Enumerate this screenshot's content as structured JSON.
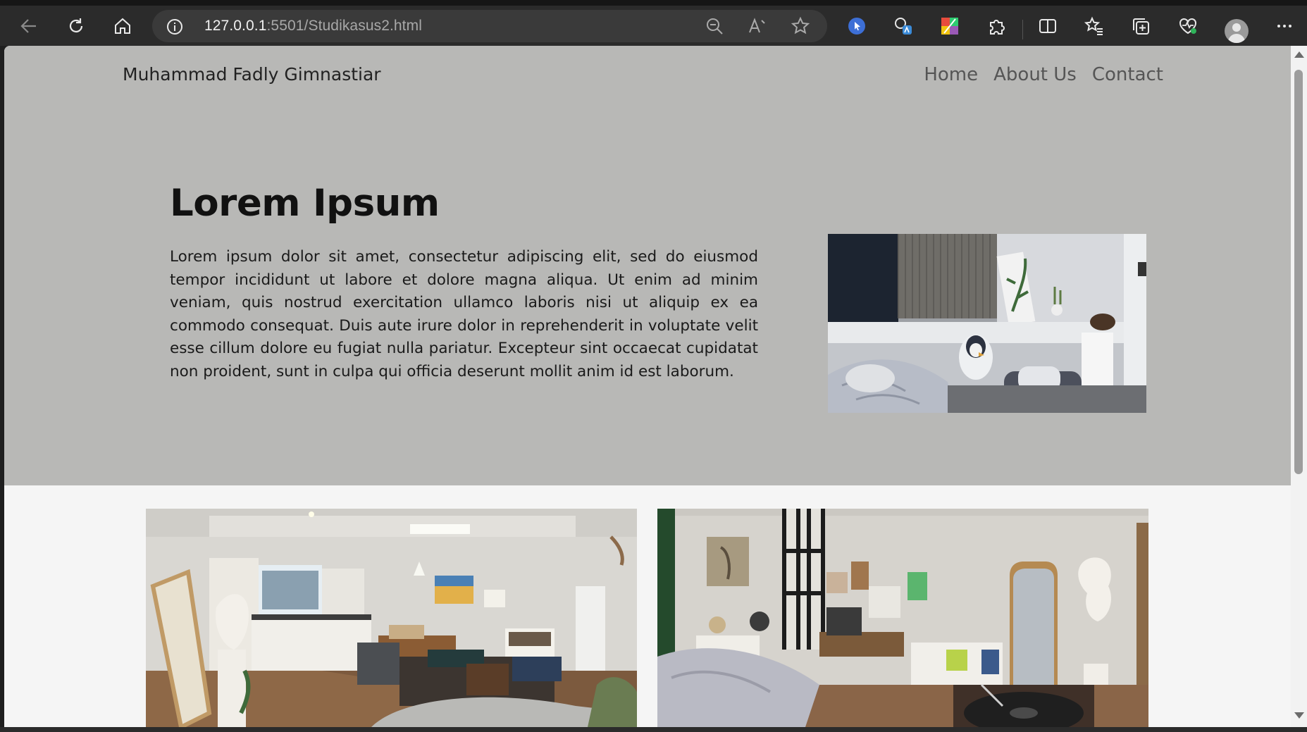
{
  "browser": {
    "url_host": "127.0.0.1",
    "url_rest": ":5501/Studikasus2.html",
    "icons": [
      "back-icon",
      "refresh-icon",
      "home-icon",
      "info-icon",
      "zoom-out-icon",
      "read-aloud-icon",
      "favorite-star-icon",
      "extension-cursor-icon",
      "extension-translate-icon",
      "extension-color-icon",
      "extensions-puzzle-icon",
      "split-screen-icon",
      "favorites-icon",
      "collections-icon",
      "browser-health-icon",
      "profile-avatar",
      "more-menu-icon"
    ]
  },
  "page": {
    "brand": "Muhammad Fadly Gimnastiar",
    "nav": [
      "Home",
      "About Us",
      "Contact"
    ],
    "hero_title": "Lorem Ipsum",
    "hero_text": "Lorem ipsum dolor sit amet, consectetur adipiscing elit, sed do eiusmod tempor incididunt ut labore et dolore magna aliqua. Ut enim ad minim veniam, quis nostrud exercitation ullamco laboris nisi ut aliquip ex ea commodo consequat. Duis aute irure dolor in reprehenderit in voluptate velit esse cillum dolore eu fugiat nulla pariatur. Excepteur sint occaecat cupidatat non proident, sunt in culpa qui officia deserunt mollit anim id est laborum.",
    "colors": {
      "hero_bg": "#b8b8b6",
      "page_bg": "#f5f5f5"
    }
  }
}
